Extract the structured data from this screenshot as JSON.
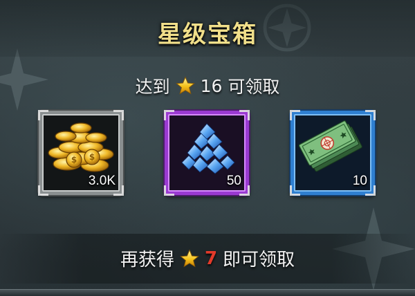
{
  "dialog": {
    "title": "星级宝箱",
    "requirement": {
      "prefix": "达到",
      "star_icon": "star-icon",
      "stars_required": "16",
      "suffix": "可领取"
    },
    "rewards": [
      {
        "item": "gold-coins",
        "icon": "gold-coins-icon",
        "quantity": "3.0K",
        "frame_color": "#8a8f90"
      },
      {
        "item": "diamonds",
        "icon": "diamonds-icon",
        "quantity": "50",
        "frame_color": "#9a3ad1"
      },
      {
        "item": "banknotes",
        "icon": "banknote-icon",
        "quantity": "10",
        "frame_color": "#2f7fd0"
      }
    ],
    "progress": {
      "prefix": "再获得",
      "star_icon": "star-icon",
      "stars_remaining": "7",
      "suffix": "即可领取",
      "remaining_color": "#e23a2a"
    }
  }
}
